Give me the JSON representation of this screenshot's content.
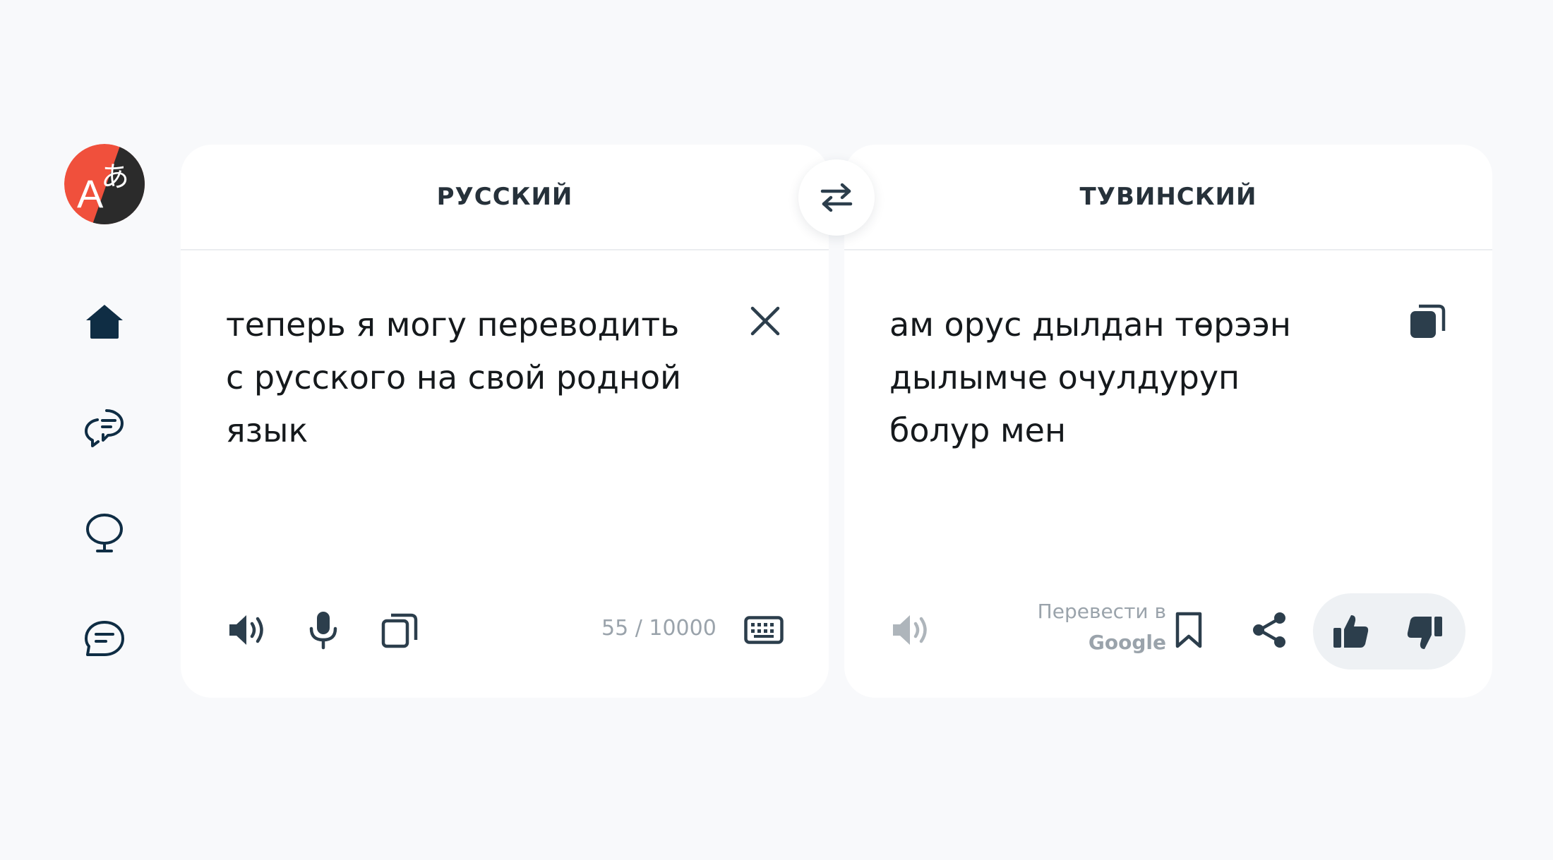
{
  "source": {
    "language": "РУССКИЙ",
    "text": "теперь я могу переводить\nс русского на свой родной\nязык",
    "counter": "55 / 10000"
  },
  "target": {
    "language": "ТУВИНСКИЙ",
    "text": "ам орус дылдан төрээн\nдылымче очулдуруп\nболур мен",
    "translate_in_label": "Перевести в",
    "translate_in_brand": "Google"
  },
  "icons": {
    "logo": "translator-logo-icon",
    "nav": [
      "home-icon",
      "chat-icon",
      "bubble-icon",
      "message-icon"
    ],
    "swap": "swap-arrows-icon",
    "source_actions": [
      "speaker-icon",
      "microphone-icon",
      "copy-icon",
      "keyboard-icon",
      "close-icon"
    ],
    "target_actions": [
      "speaker-icon",
      "copy-icon",
      "bookmark-icon",
      "share-icon",
      "thumbs-up-icon",
      "thumbs-down-icon"
    ]
  },
  "colors": {
    "background": "#f8f9fb",
    "panel": "#ffffff",
    "icon": "#2c3e4c",
    "muted": "#9aa3ab",
    "logo_red": "#f0503c",
    "logo_dark": "#2b2b2b"
  }
}
